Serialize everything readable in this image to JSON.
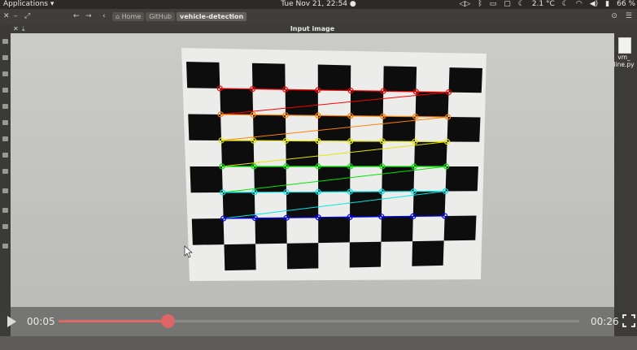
{
  "top_panel": {
    "apps_menu": "Applications ▾",
    "clock": "Tue Nov 21, 22:54 ●",
    "weather": "2.1 °C",
    "battery": "66 %"
  },
  "file_manager": {
    "breadcrumbs": [
      "Home",
      "GitHub",
      "vehicle-detection"
    ],
    "desktop_file": [
      "vm_",
      "line.py"
    ]
  },
  "image_window": {
    "title": "Input image"
  },
  "video": {
    "current_time": "00:05",
    "total_time": "00:26",
    "progress": 0.21
  },
  "colors": {
    "progress": "#e06868",
    "corner_rows": [
      "#ff0000",
      "#ff8000",
      "#e6e600",
      "#00e600",
      "#00e6e6",
      "#0000ff"
    ]
  }
}
